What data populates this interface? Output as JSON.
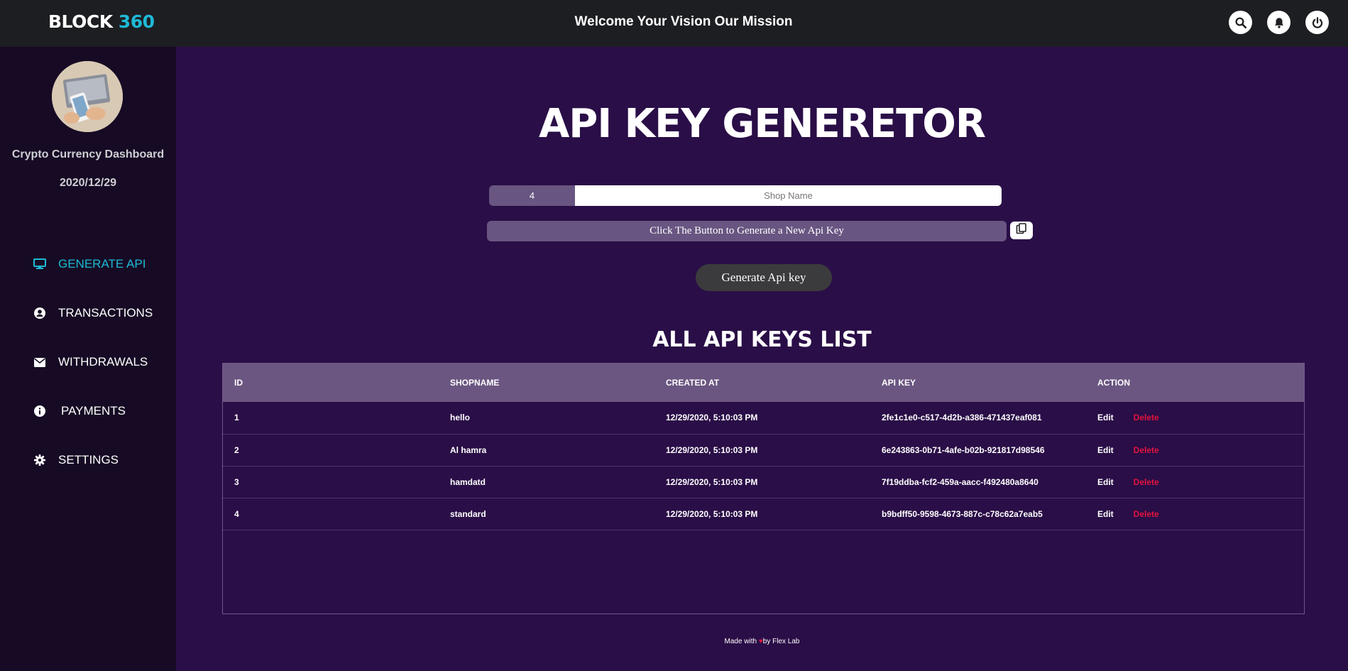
{
  "header": {
    "brand_word": "BLOCK",
    "brand_num": "360",
    "title": "Welcome Your Vision Our Mission",
    "icons": [
      "search-icon",
      "bell-icon",
      "power-icon"
    ]
  },
  "sidebar": {
    "title": "Crypto Currency Dashboard",
    "date": "2020/12/29",
    "items": [
      {
        "label": "GENERATE API",
        "icon": "monitor-icon",
        "active": true
      },
      {
        "label": "TRANSACTIONS",
        "icon": "user-circle-icon",
        "active": false
      },
      {
        "label": "WITHDRAWALS",
        "icon": "envelope-icon",
        "active": false
      },
      {
        "label": "PAYMENTS",
        "icon": "info-icon",
        "active": false
      },
      {
        "label": "SETTINGS",
        "icon": "gear-icon",
        "active": false
      }
    ]
  },
  "generator": {
    "title": "API KEY GENERETOR",
    "id_value": "4",
    "shop_placeholder": "Shop Name",
    "key_text": "Click The Button to Generate a New Api Key",
    "button_label": "Generate Api key"
  },
  "list": {
    "title": "ALL API KEYS LIST",
    "columns": [
      "ID",
      "SHOPNAME",
      "CREATED AT",
      "API KEY",
      "ACTION"
    ],
    "rows": [
      {
        "id": "1",
        "shop": "hello",
        "created": "12/29/2020, 5:10:03 PM",
        "key": "2fe1c1e0-c517-4d2b-a386-471437eaf081"
      },
      {
        "id": "2",
        "shop": "Al hamra",
        "created": "12/29/2020, 5:10:03 PM",
        "key": "6e243863-0b71-4afe-b02b-921817d98546"
      },
      {
        "id": "3",
        "shop": "hamdatd",
        "created": "12/29/2020, 5:10:03 PM",
        "key": "7f19ddba-fcf2-459a-aacc-f492480a8640"
      },
      {
        "id": "4",
        "shop": "standard",
        "created": "12/29/2020, 5:10:03 PM",
        "key": "b9bdff50-9598-4673-887c-c78c62a7eab5"
      }
    ],
    "edit_label": "Edit",
    "delete_label": "Delete"
  },
  "footer": {
    "prefix": "Made with",
    "suffix": "by Flex Lab"
  },
  "colors": {
    "accent": "#1fb9d6",
    "main_bg": "#2a0e47",
    "sidebar_bg": "#160a24",
    "header_bg": "#1d1e22",
    "table_header": "#6b5681",
    "delete": "#e0143c"
  }
}
